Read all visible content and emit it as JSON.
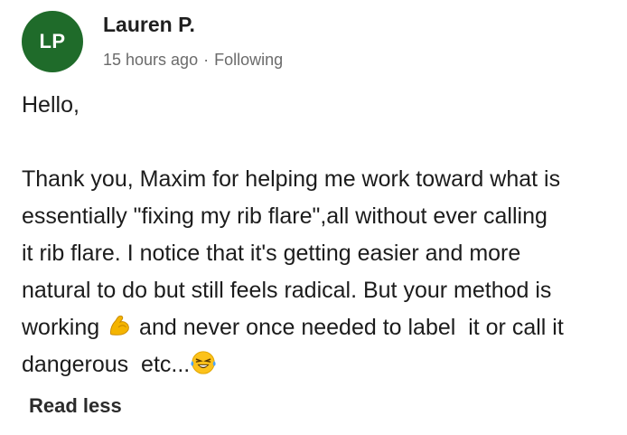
{
  "author": {
    "initials": "LP",
    "name": "Lauren P.",
    "avatar_color": "#1f6b2a"
  },
  "meta": {
    "time": "15 hours ago",
    "separator": "·",
    "follow_status": "Following"
  },
  "post": {
    "greeting": "Hello,",
    "lines": [
      "Thank you, Maxim for helping me work toward what is",
      "essentially \"fixing my rib flare\",all without ever calling",
      "it rib flare. I notice  that it's getting  easier  and more",
      "natural to do but still feels  radical. But your method is"
    ],
    "line5_before": "working ",
    "line5_after": " and never once needed to label  it or call it",
    "line6_before": "dangerous  etc...",
    "emojis": [
      "flexed-biceps-icon",
      "laughing-crying-face-icon"
    ]
  },
  "actions": {
    "read_less_label": "Read less"
  }
}
